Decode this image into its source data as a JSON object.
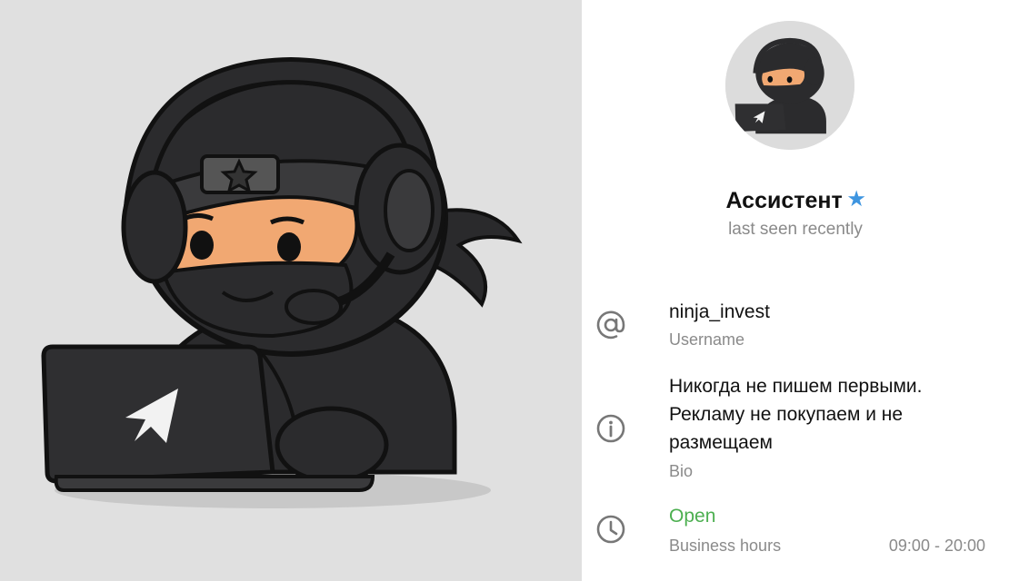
{
  "profile": {
    "name": "Ассистент",
    "verified_icon": "star-badge-icon",
    "status": "last seen recently"
  },
  "info": {
    "username": {
      "icon": "at-sign-icon",
      "value": "ninja_invest",
      "label": "Username"
    },
    "bio": {
      "icon": "info-icon",
      "lines": [
        "Никогда не пишем первыми.",
        "Рекламу не покупаем и не",
        "размещаем"
      ],
      "label": "Bio"
    },
    "business_hours": {
      "icon": "clock-icon",
      "status": "Open",
      "label": "Business hours",
      "hours": "09:00 - 20:00",
      "status_color": "#4caf50"
    }
  },
  "colors": {
    "accent": "#3e95e0",
    "secondary_text": "#8a8a8a",
    "left_background": "#e0e0e0"
  }
}
